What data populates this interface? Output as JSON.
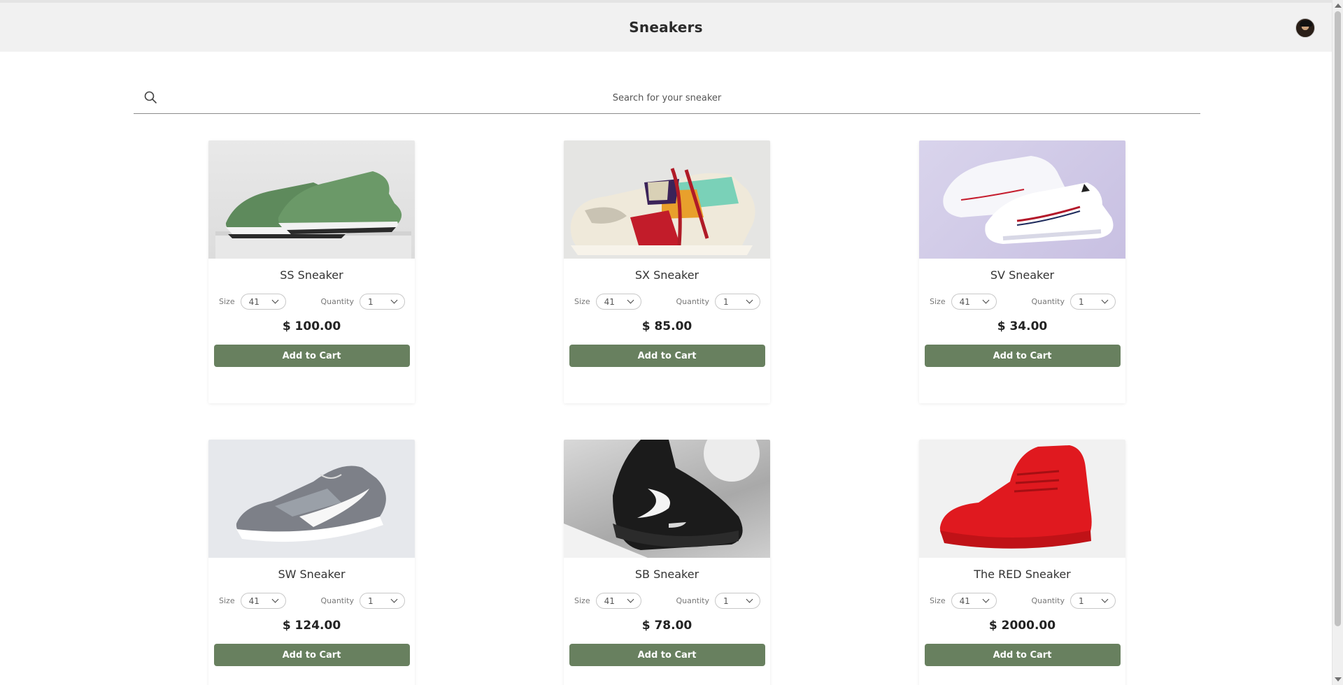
{
  "header": {
    "title": "Sneakers"
  },
  "search": {
    "placeholder": "Search for your sneaker"
  },
  "products": [
    {
      "name": "SS Sneaker",
      "size_label": "Size",
      "size": "41",
      "quantity_label": "Quantity",
      "quantity": "1",
      "price": "$ 100.00",
      "button": "Add to Cart",
      "photo": "green-sneaker-photo"
    },
    {
      "name": "SX Sneaker",
      "size_label": "Size",
      "size": "41",
      "quantity_label": "Quantity",
      "quantity": "1",
      "price": "$ 85.00",
      "button": "Add to Cart",
      "photo": "multicolor-sneaker-photo"
    },
    {
      "name": "SV Sneaker",
      "size_label": "Size",
      "size": "41",
      "quantity_label": "Quantity",
      "quantity": "1",
      "price": "$ 34.00",
      "button": "Add to Cart",
      "photo": "white-sneaker-photo"
    },
    {
      "name": "SW Sneaker",
      "size_label": "Size",
      "size": "41",
      "quantity_label": "Quantity",
      "quantity": "1",
      "price": "$ 124.00",
      "button": "Add to Cart",
      "photo": "grey-knit-sneaker-photo"
    },
    {
      "name": "SB Sneaker",
      "size_label": "Size",
      "size": "41",
      "quantity_label": "Quantity",
      "quantity": "1",
      "price": "$ 78.00",
      "button": "Add to Cart",
      "photo": "black-sneaker-photo"
    },
    {
      "name": "The RED Sneaker",
      "size_label": "Size",
      "size": "41",
      "quantity_label": "Quantity",
      "quantity": "1",
      "price": "$ 2000.00",
      "button": "Add to Cart",
      "photo": "red-sneaker-photo"
    }
  ],
  "colors": {
    "accent": "#68805f",
    "header_bg": "#f1f1f1"
  }
}
